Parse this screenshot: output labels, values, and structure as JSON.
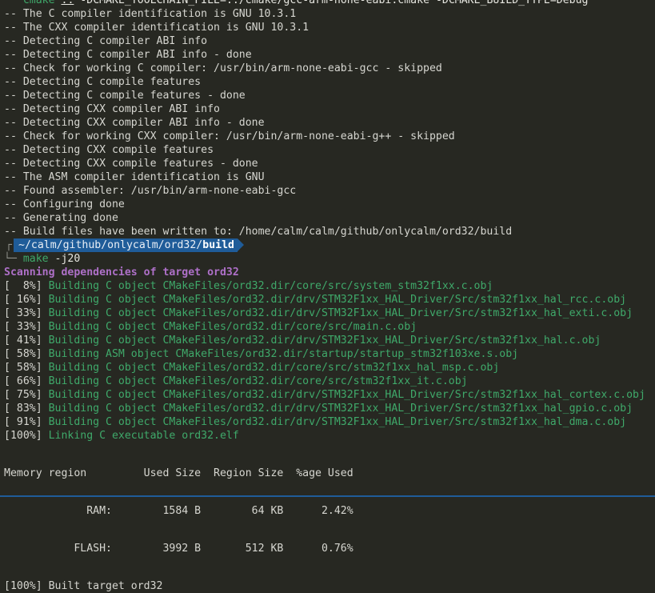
{
  "cmake_line": {
    "corner": "└─",
    "cmd": "cmake",
    "dotdot": "..",
    "args": " -DCMAKE_TOOLCHAIN_FILE=../cmake/gcc-arm-none-eabi.cmake -DCMAKE_BUILD_TYPE=Debug"
  },
  "cmake_output": [
    "-- The C compiler identification is GNU 10.3.1",
    "-- The CXX compiler identification is GNU 10.3.1",
    "-- Detecting C compiler ABI info",
    "-- Detecting C compiler ABI info - done",
    "-- Check for working C compiler: /usr/bin/arm-none-eabi-gcc - skipped",
    "-- Detecting C compile features",
    "-- Detecting C compile features - done",
    "-- Detecting CXX compiler ABI info",
    "-- Detecting CXX compiler ABI info - done",
    "-- Check for working CXX compiler: /usr/bin/arm-none-eabi-g++ - skipped",
    "-- Detecting CXX compile features",
    "-- Detecting CXX compile features - done",
    "-- The ASM compiler identification is GNU",
    "-- Found assembler: /usr/bin/arm-none-eabi-gcc",
    "-- Configuring done",
    "-- Generating done",
    "-- Build files have been written to: /home/calm/calm/github/onlycalm/ord32/build"
  ],
  "prompt": {
    "corner": "┌",
    "path_prefix": "~/calm/github/onlycalm/ord32/",
    "path_last": "build"
  },
  "make_line": {
    "corner": "└─",
    "cmd": "make",
    "args": " -j20"
  },
  "scanning": "Scanning dependencies of target ord32",
  "build_lines": [
    {
      "pct": "[  8%]",
      "text": " Building C object CMakeFiles/ord32.dir/core/src/system_stm32f1xx.c.obj"
    },
    {
      "pct": "[ 16%]",
      "text": " Building C object CMakeFiles/ord32.dir/drv/STM32F1xx_HAL_Driver/Src/stm32f1xx_hal_rcc.c.obj"
    },
    {
      "pct": "[ 33%]",
      "text": " Building C object CMakeFiles/ord32.dir/drv/STM32F1xx_HAL_Driver/Src/stm32f1xx_hal_exti.c.obj"
    },
    {
      "pct": "[ 33%]",
      "text": " Building C object CMakeFiles/ord32.dir/core/src/main.c.obj"
    },
    {
      "pct": "[ 41%]",
      "text": " Building C object CMakeFiles/ord32.dir/drv/STM32F1xx_HAL_Driver/Src/stm32f1xx_hal.c.obj"
    },
    {
      "pct": "[ 58%]",
      "text": " Building ASM object CMakeFiles/ord32.dir/startup/startup_stm32f103xe.s.obj"
    },
    {
      "pct": "[ 58%]",
      "text": " Building C object CMakeFiles/ord32.dir/core/src/stm32f1xx_hal_msp.c.obj"
    },
    {
      "pct": "[ 66%]",
      "text": " Building C object CMakeFiles/ord32.dir/core/src/stm32f1xx_it.c.obj"
    },
    {
      "pct": "[ 75%]",
      "text": " Building C object CMakeFiles/ord32.dir/drv/STM32F1xx_HAL_Driver/Src/stm32f1xx_hal_cortex.c.obj"
    },
    {
      "pct": "[ 83%]",
      "text": " Building C object CMakeFiles/ord32.dir/drv/STM32F1xx_HAL_Driver/Src/stm32f1xx_hal_gpio.c.obj"
    },
    {
      "pct": "[ 91%]",
      "text": " Building C object CMakeFiles/ord32.dir/drv/STM32F1xx_HAL_Driver/Src/stm32f1xx_hal_dma.c.obj"
    }
  ],
  "linking": {
    "pct": "[100%]",
    "text": " Linking C executable ord32.elf"
  },
  "memory_table": {
    "header": "Memory region         Used Size  Region Size  %age Used",
    "rows": [
      "             RAM:        1584 B        64 KB      2.42%",
      "           FLASH:        3992 B       512 KB      0.76%"
    ]
  },
  "built": {
    "pct": "[100%]",
    "text": " Built target ord32"
  },
  "colors": {
    "background": "#272822",
    "green": "#3fa96a",
    "purple": "#ae70c8",
    "prompt_bg": "#1f5c99"
  }
}
